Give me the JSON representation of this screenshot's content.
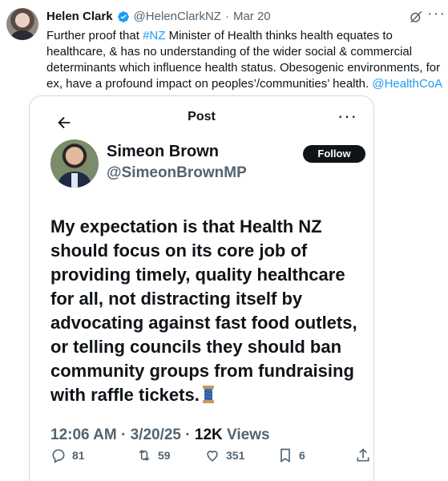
{
  "tweet": {
    "author_name": "Helen Clark",
    "handle": "@HelenClarkNZ",
    "separator": "·",
    "date": "Mar 20",
    "text_part1": "Further proof that ",
    "hashtag": "#NZ",
    "text_part2": " Minister of Health thinks health equates to healthcare, & has no understanding of the wider social & commercial determinants which influence health status. Obesogenic environments, for ex, have a profound impact on peoples’/communities’ health. ",
    "mention": "@HealthCoA"
  },
  "quoted_post": {
    "page_title": "Post",
    "author_name": "Simeon Brown",
    "handle": "@SimeonBrownMP",
    "follow_label": "Follow",
    "text": "My expectation is that Health NZ should focus on its core job of providing timely, quality healthcare for all, not distracting itself by advocating against fast food outlets, or telling councils they should ban community groups from fundraising with raffle tickets.",
    "time": "12:06 AM",
    "separator": "·",
    "date": "3/20/25",
    "views_count": "12K",
    "views_label": "Views",
    "stats": {
      "replies": "81",
      "reposts": "59",
      "likes": "351",
      "bookmarks": "6"
    }
  },
  "icons": [
    "verified-badge-icon",
    "grok-icon",
    "more-icon",
    "back-arrow-icon",
    "spool-emoji-icon",
    "reply-icon",
    "repost-icon",
    "like-icon",
    "bookmark-icon",
    "share-icon"
  ],
  "colors": {
    "link": "#1d9bf0",
    "verified": "#1d9bf0",
    "text": "#0f1419",
    "muted": "#536471",
    "border": "#cfd9de"
  }
}
